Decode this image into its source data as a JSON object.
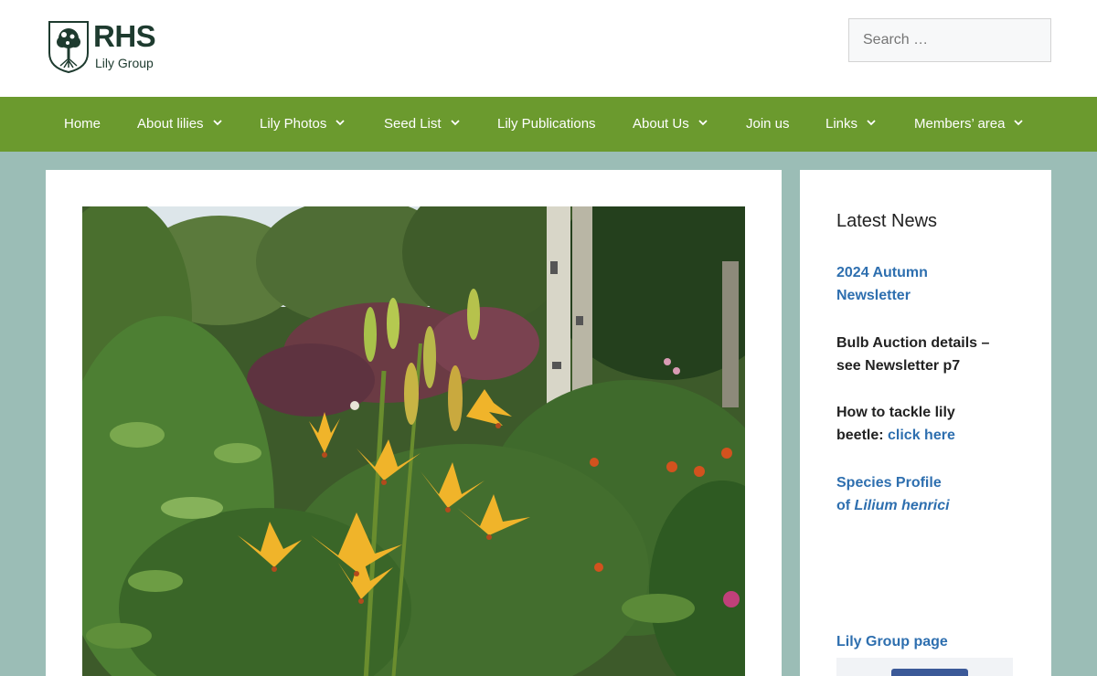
{
  "header": {
    "logo": {
      "brand": "RHS",
      "subtitle": "Lily Group"
    },
    "search": {
      "placeholder": "Search …"
    }
  },
  "nav": {
    "items": [
      {
        "label": "Home",
        "has_submenu": false
      },
      {
        "label": "About lilies",
        "has_submenu": true
      },
      {
        "label": "Lily Photos",
        "has_submenu": true
      },
      {
        "label": "Seed List",
        "has_submenu": true
      },
      {
        "label": "Lily Publications",
        "has_submenu": false
      },
      {
        "label": "About Us",
        "has_submenu": true
      },
      {
        "label": "Join us",
        "has_submenu": false
      },
      {
        "label": "Links",
        "has_submenu": true
      },
      {
        "label": "Members’ area",
        "has_submenu": true
      }
    ]
  },
  "sidebar": {
    "title": "Latest News",
    "news": {
      "item1": {
        "line1": "2024 Autumn",
        "line2": "Newsletter"
      },
      "item2": {
        "line1": "Bulb Auction details –",
        "line2": "see Newsletter p7"
      },
      "item3": {
        "line1": "How to tackle lily",
        "prefix": "beetle: ",
        "link": "click here"
      },
      "item4": {
        "line1": "Species Profile",
        "prefix": "of ",
        "species": "Lilium henrici"
      }
    },
    "lily_group_page": "Lily Group page"
  },
  "colors": {
    "nav_bg": "#6b9a2e",
    "page_bg": "#9bbdb6",
    "link": "#2e6faf",
    "logo": "#1e3b2f"
  }
}
